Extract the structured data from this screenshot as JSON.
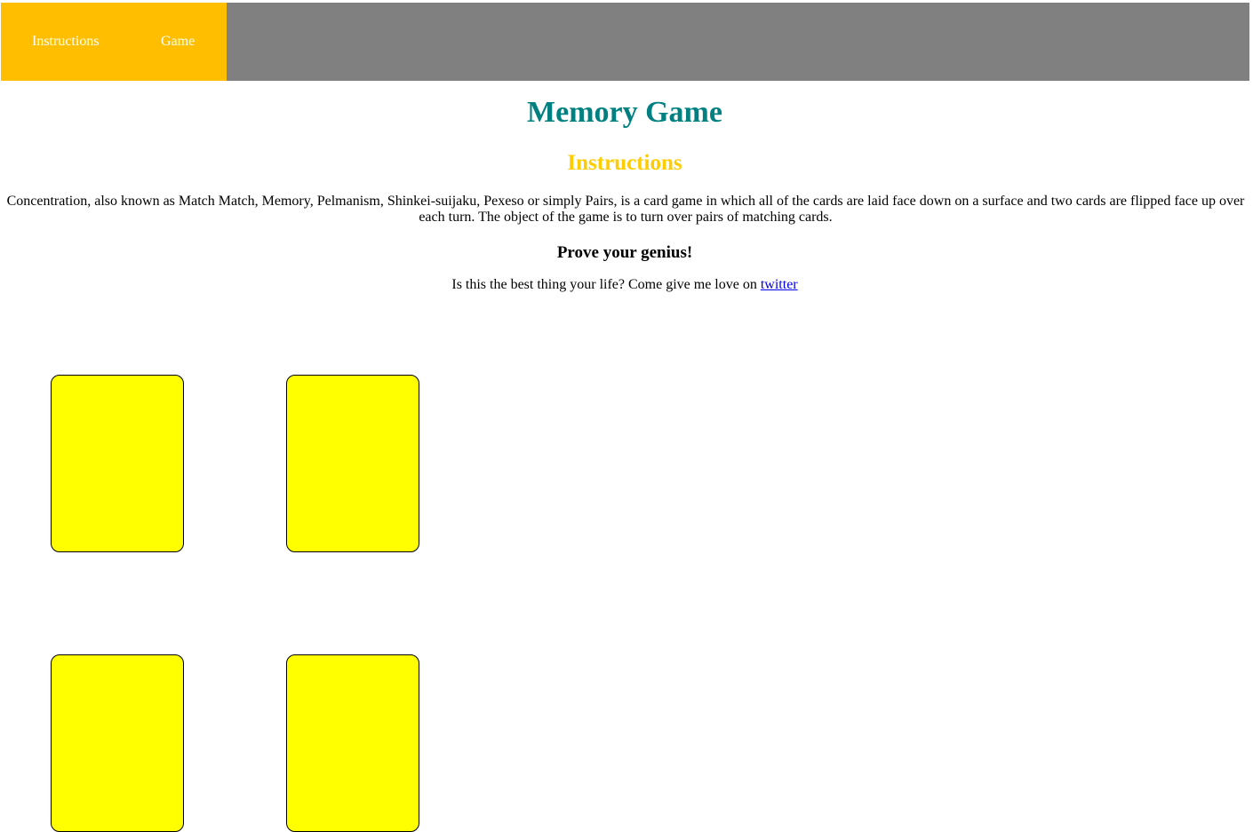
{
  "nav": {
    "instructions_label": "Instructions",
    "game_label": "Game"
  },
  "title": "Memory Game",
  "subtitle": "Instructions",
  "description": "Concentration, also known as Match Match, Memory, Pelmanism, Shinkei-suijaku, Pexeso or simply Pairs, is a card game in which all of the cards are laid face down on a surface and two cards are flipped face up over each turn. The object of the game is to turn over pairs of matching cards.",
  "prove": "Prove your genius!",
  "love": {
    "text": "Is this the best thing your life? Come give me love on ",
    "link_label": "twitter"
  },
  "colors": {
    "navbar": "#808080",
    "nav_active": "#ffbf00",
    "title": "#008080",
    "subtitle": "#ffcc00",
    "card": "#ffff00"
  },
  "cards_count_visible": 4
}
